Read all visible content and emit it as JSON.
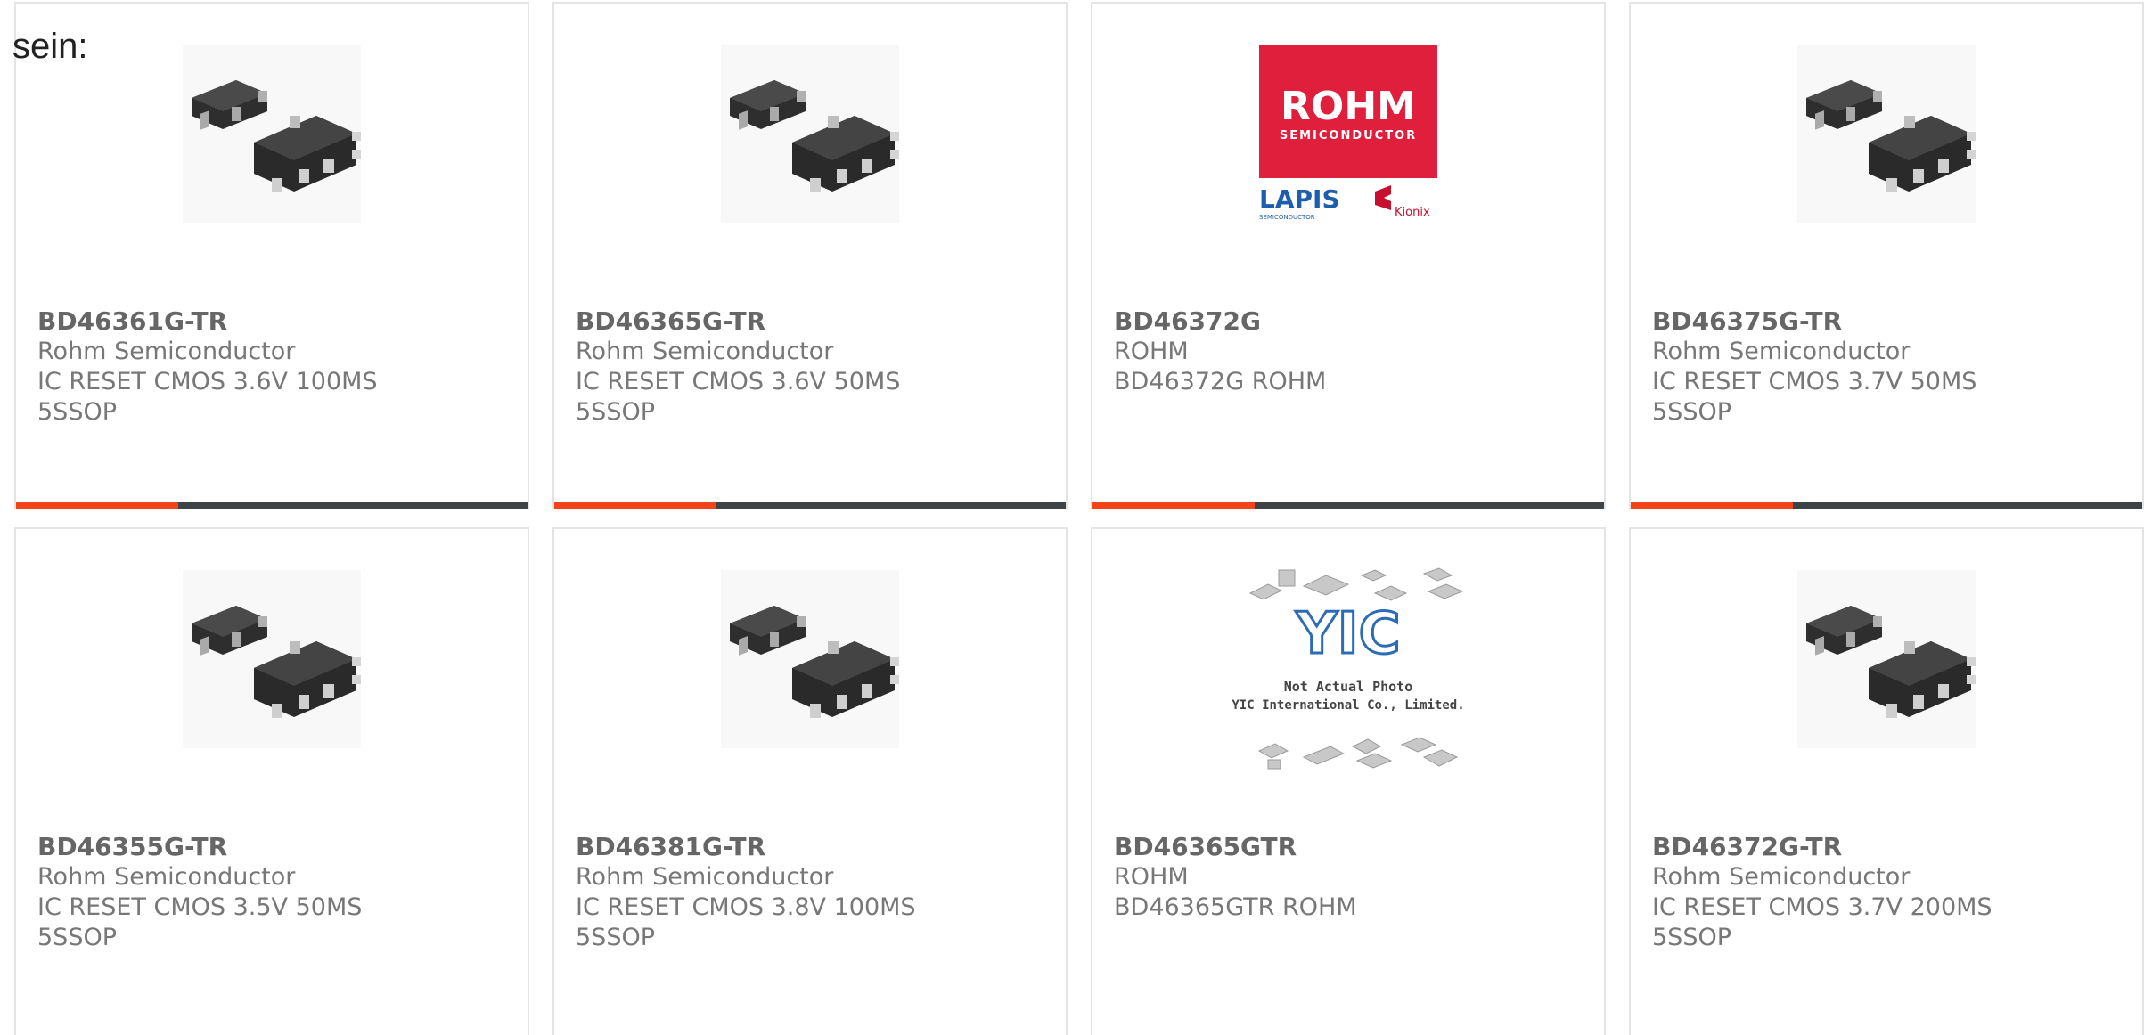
{
  "intro_text": "sein:",
  "colors": {
    "accent": "#f2431a",
    "bar": "#3e4347",
    "border": "#e4e4e4",
    "text": "#777777"
  },
  "products": [
    {
      "part": "BD46361G-TR",
      "maker": "Rohm Semiconductor",
      "desc": "IC RESET CMOS 3.6V 100MS",
      "desc2": "5SSOP",
      "image": "chip-photo"
    },
    {
      "part": "BD46365G-TR",
      "maker": "Rohm Semiconductor",
      "desc": "IC RESET CMOS 3.6V 50MS",
      "desc2": "5SSOP",
      "image": "chip-photo"
    },
    {
      "part": "BD46372G",
      "maker": "ROHM",
      "desc": "BD46372G ROHM",
      "desc2": "",
      "image": "rohm-logo",
      "logo_text": {
        "brand": "ROHM",
        "brand_sub": "SEMICONDUCTOR",
        "lapis": "LAPIS",
        "lapis_sub": "SEMICONDUCTOR",
        "kionix": "Kionix"
      }
    },
    {
      "part": "BD46375G-TR",
      "maker": "Rohm Semiconductor",
      "desc": "IC RESET CMOS 3.7V 50MS",
      "desc2": "5SSOP",
      "image": "chip-photo"
    },
    {
      "part": "BD46355G-TR",
      "maker": "Rohm Semiconductor",
      "desc": "IC RESET CMOS 3.5V 50MS",
      "desc2": "5SSOP",
      "image": "chip-photo"
    },
    {
      "part": "BD46381G-TR",
      "maker": "Rohm Semiconductor",
      "desc": "IC RESET CMOS 3.8V 100MS",
      "desc2": "5SSOP",
      "image": "chip-photo"
    },
    {
      "part": "BD46365GTR",
      "maker": "ROHM",
      "desc": "BD46365GTR ROHM",
      "desc2": "",
      "image": "not-actual-photo",
      "placeholder_text": {
        "logo": "YIC",
        "line1": "Not Actual Photo",
        "line2": "YIC International Co., Limited."
      }
    },
    {
      "part": "BD46372G-TR",
      "maker": "Rohm Semiconductor",
      "desc": "IC RESET CMOS 3.7V 200MS",
      "desc2": "5SSOP",
      "image": "chip-photo"
    }
  ]
}
